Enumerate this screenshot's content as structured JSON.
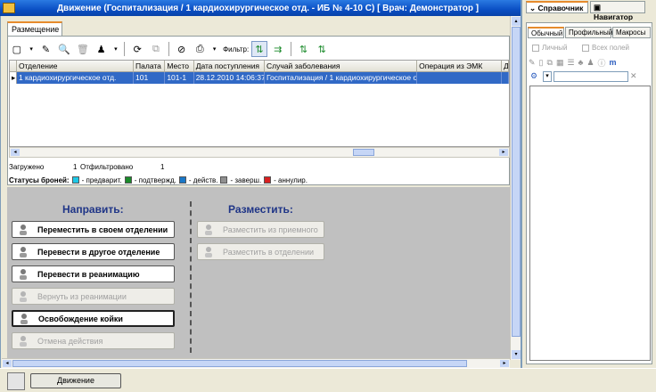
{
  "window": {
    "title": "Движение (Госпитализация / 1 кардиохирургическое отд.  - ИБ № 4-10 С)  [ Врач: Демонстратор ]"
  },
  "tabs": {
    "main_tab": "Размещение"
  },
  "toolbar": {
    "filter_label": "Фильтр:"
  },
  "table": {
    "columns": [
      "Отделение",
      "Палата",
      "Место",
      "Дата поступления",
      "Случай заболевания",
      "Операция из ЭМК",
      "Д"
    ],
    "rows": [
      [
        "1 кардиохирургическое отд.",
        "101",
        "101-1",
        "28.12.2010 14:06:37",
        "Госпитализация / 1 кардиохирургическое от",
        "",
        ""
      ]
    ]
  },
  "stats": {
    "loaded_label": "Загружено",
    "loaded_value": "1",
    "filtered_label": "Отфильтровано",
    "filtered_value": "1"
  },
  "statuses": {
    "label": "Статусы броней:",
    "items": [
      {
        "text": "- предварит.",
        "color": "#1ec8e6"
      },
      {
        "text": "- подтвержд.",
        "color": "#1a8a2a"
      },
      {
        "text": "- действ.",
        "color": "#1a78c8"
      },
      {
        "text": "- заверш.",
        "color": "#909090"
      },
      {
        "text": "- аннулир.",
        "color": "#d82020"
      }
    ]
  },
  "direct": {
    "header": "Направить:",
    "buttons": [
      "Переместить в своем отделении",
      "Перевести в другое отделение",
      "Перевести в реанимацию",
      "Вернуть из реанимации",
      "Освобождение койки",
      "Отмена действия"
    ]
  },
  "place": {
    "header": "Разместить:",
    "buttons": [
      "Разместить из приемного",
      "Разместить в отделении"
    ]
  },
  "right": {
    "tabs": [
      "Справочник",
      "Навигатор"
    ],
    "subtabs": [
      "Обычный",
      "Профильный",
      "Макросы"
    ],
    "checks": [
      "Личный",
      "Всех полей"
    ]
  },
  "taskbar": {
    "button": "Движение"
  }
}
